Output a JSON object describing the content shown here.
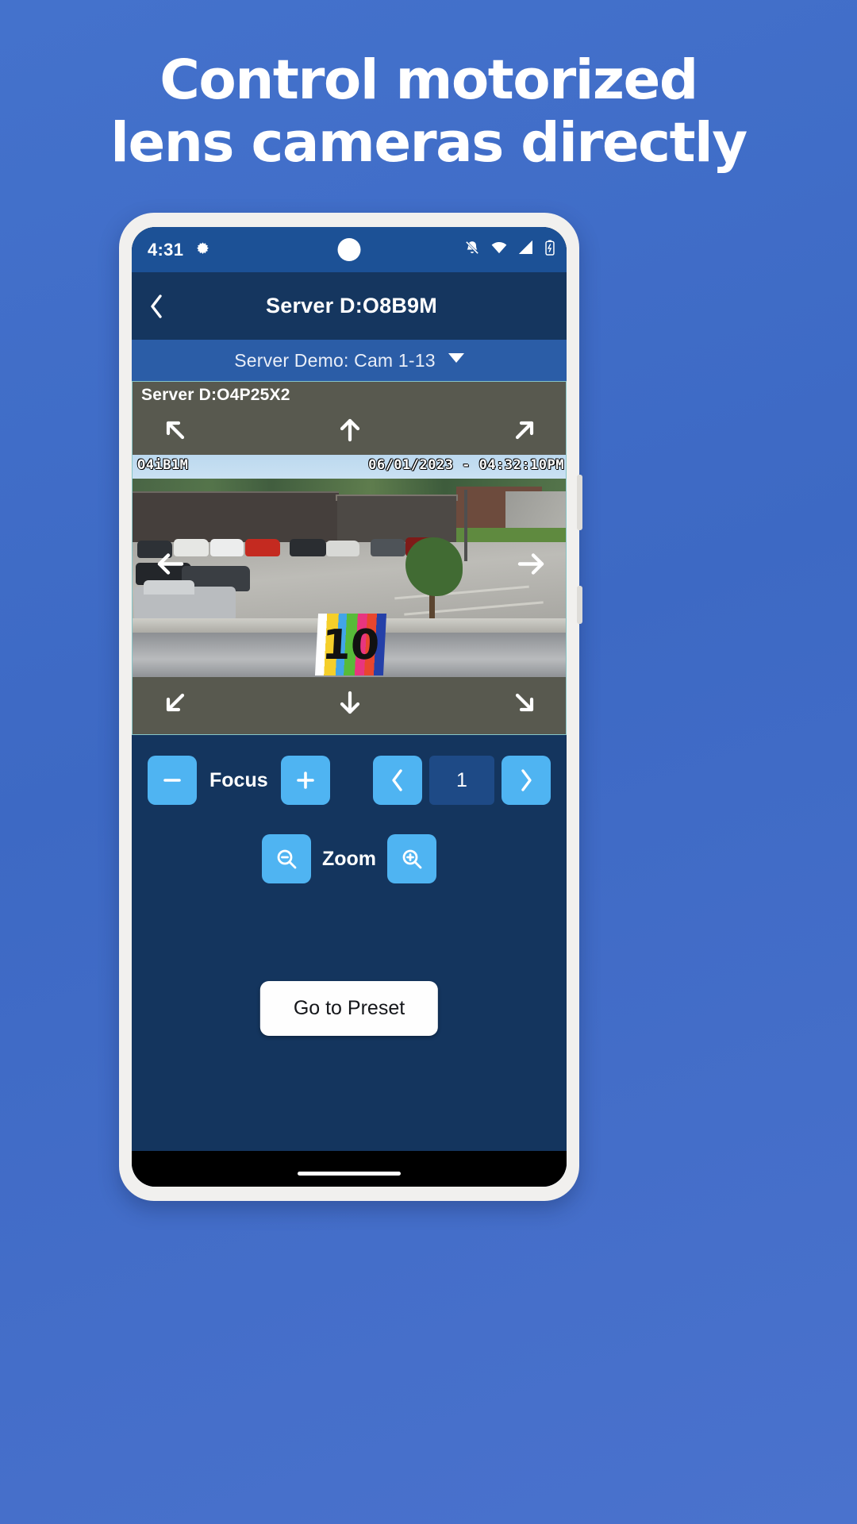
{
  "promo": {
    "headline_line1": "Control motorized",
    "headline_line2": "lens cameras directly",
    "background_color": "#3f6cc7"
  },
  "status_bar": {
    "time": "4:31",
    "icons": [
      "gear-icon",
      "notifications-off-icon",
      "wifi-icon",
      "signal-icon",
      "battery-charging-icon"
    ],
    "background_color": "#1c5196"
  },
  "app_bar": {
    "back_label": "‹",
    "title": "Server D:O8B9M",
    "background_color": "#15365f"
  },
  "camera_selector": {
    "label": "Server Demo: Cam 1-13",
    "caret": "▼",
    "background_color": "#2b5da7"
  },
  "camera_view": {
    "name": "Server D:O4P25X2",
    "overlay_camera_id": "O4iB1M",
    "overlay_timestamp": "06/01/2023 - 04:32:10PM",
    "chart_number": "10",
    "ptz": {
      "up_left": "↖",
      "up": "↑",
      "up_right": "↗",
      "left": "←",
      "right": "→",
      "down_left": "↙",
      "down": "↓",
      "down_right": "↘"
    },
    "panel_color": "#58594f",
    "border_color": "#86c5c8"
  },
  "controls": {
    "focus_label": "Focus",
    "focus_minus": "−",
    "focus_plus": "+",
    "zoom_label": "Zoom",
    "zoom_out_icon": "zoom-out-icon",
    "zoom_in_icon": "zoom-in-icon",
    "preset_prev": "‹",
    "preset_value": "1",
    "preset_next": "›",
    "go_to_preset": "Go to Preset",
    "accent_color": "#4fb4f2",
    "panel_color": "#14355e"
  }
}
